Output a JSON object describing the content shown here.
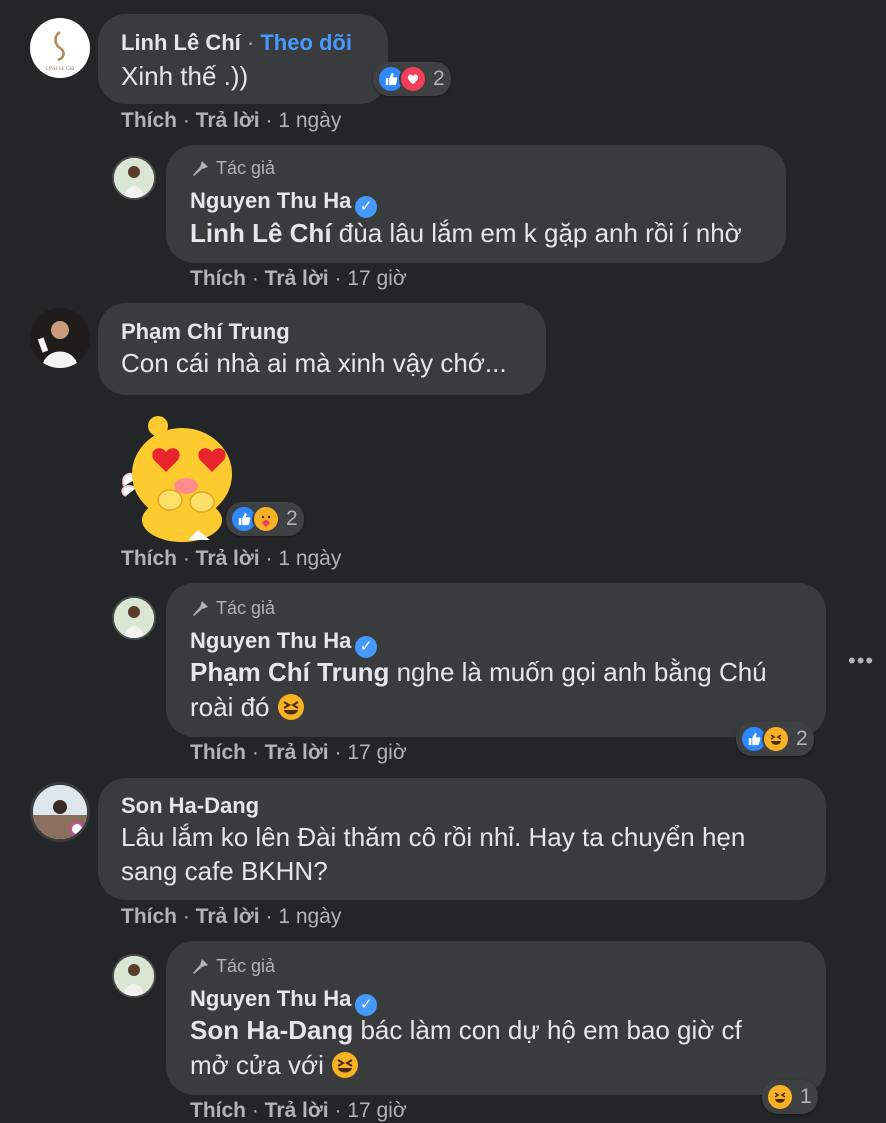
{
  "comments": [
    {
      "author": "Linh Lê Chí",
      "follow_sep": " · ",
      "follow_label": "Theo dõi",
      "text": "Xinh thế .))",
      "avatar_text": "LINH LE CHI",
      "reactions": {
        "icons": [
          "like-icon",
          "love-icon"
        ],
        "count": "2"
      },
      "actions": {
        "like": "Thích",
        "sep": " · ",
        "reply": "Trả lời",
        "time": "1 ngày"
      },
      "reply": {
        "badge": "Tác giả",
        "author": "Nguyen Thu Ha",
        "mention": "Linh Lê Chí",
        "text": " đùa lâu lắm em k gặp anh rồi í nhờ",
        "actions": {
          "like": "Thích",
          "sep": " · ",
          "reply": "Trả lời",
          "time": "17 giờ"
        }
      }
    },
    {
      "author": "Phạm Chí Trung",
      "text": "Con cái nhà ai mà xinh vậy chớ...",
      "sticker": "heart-eyes-sticker",
      "reactions": {
        "icons": [
          "like-icon",
          "care-icon"
        ],
        "count": "2"
      },
      "actions": {
        "like": "Thích",
        "sep": " · ",
        "reply": "Trả lời",
        "time": "1 ngày"
      },
      "reply": {
        "badge": "Tác giả",
        "author": "Nguyen Thu Ha",
        "mention": "Phạm Chí Trung",
        "text": " nghe là muốn gọi anh bằng Chú",
        "text2": "roài đó",
        "reactions": {
          "icons": [
            "like-icon",
            "haha-icon"
          ],
          "count": "2"
        },
        "actions": {
          "like": "Thích",
          "sep": " · ",
          "reply": "Trả lời",
          "time": "17 giờ"
        }
      }
    },
    {
      "author": "Son Ha-Dang",
      "text": "Lâu lắm ko lên Đài thăm cô rồi nhỉ. Hay ta chuyển hẹn",
      "text2": "sang cafe BKHN?",
      "actions": {
        "like": "Thích",
        "sep": " · ",
        "reply": "Trả lời",
        "time": "1 ngày"
      },
      "reply": {
        "badge": "Tác giả",
        "author": "Nguyen Thu Ha",
        "mention": "Son Ha-Dang",
        "text": " bác làm con dự hộ em bao giờ cf",
        "text2": "mở cửa với",
        "reactions": {
          "icons": [
            "haha-icon"
          ],
          "count": "1"
        },
        "actions": {
          "like": "Thích",
          "sep": " · ",
          "reply": "Trả lời",
          "time": "17 giờ"
        }
      }
    }
  ],
  "more_menu": "•••",
  "colors": {
    "background": "#242526",
    "bubble": "#3a3b3c",
    "link": "#4599ff",
    "like": "#2e89ff",
    "love": "#f33e58",
    "haha": "#f7b125"
  }
}
